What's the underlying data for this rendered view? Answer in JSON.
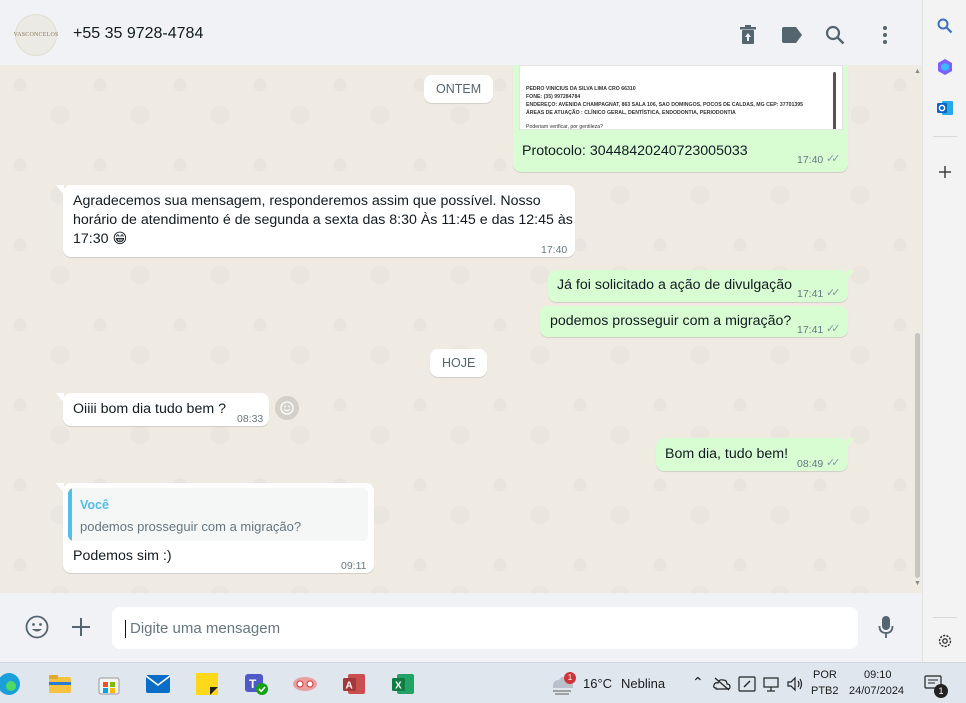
{
  "header": {
    "avatar_text": "VASCONCELOS",
    "contact_name": "+55 35 9728-4784"
  },
  "chat": {
    "date_yesterday": "ONTEM",
    "date_today": "HOJE",
    "doc_lines": [
      "PEDRO VINICIUS DA SILVA LIMA CRO 66310",
      "FONE: (35) 997284784",
      "ENDEREÇO: AVENIDA CHAMPAGNAT, 863 SALA 106, SAO DOMINGOS, POCOS DE CALDAS, MG CEP: 37701395",
      "ÁREAS DE ATUAÇÃO : CLÍNICO GERAL, DENTÍSTICA, ENDODONTIA, PERIODONTIA",
      "Poderiam verificar, por gentileza?"
    ],
    "messages": [
      {
        "text": "Protocolo: 30448420240723005033",
        "time": "17:40"
      },
      {
        "text_lines": [
          "Agradecemos sua mensagem, responderemos assim que possível. Nosso",
          "horário de atendimento é de segunda a sexta das 8:30 Às 11:45 e das 12:45 às",
          "17:30 😁"
        ],
        "time": "17:40"
      },
      {
        "text": "Já foi solicitado a ação de divulgação",
        "time": "17:41"
      },
      {
        "text": "podemos prosseguir com a migração?",
        "time": "17:41"
      },
      {
        "text": "Oiiii bom dia tudo bem ?",
        "time": "08:33"
      },
      {
        "text": "Bom dia, tudo bem!",
        "time": "08:49"
      },
      {
        "reply_author": "Você",
        "reply_text": "podemos prosseguir com a migração?",
        "text": "Podemos sim :)",
        "time": "09:11"
      }
    ]
  },
  "composer": {
    "placeholder": "Digite uma mensagem"
  },
  "taskbar": {
    "weather_temp": "16°C",
    "weather_desc": "Neblina",
    "weather_badge": "1",
    "lang_top": "POR",
    "lang_bottom": "PTB2",
    "clock_time": "09:10",
    "clock_date": "24/07/2024",
    "notif_count": "1"
  },
  "colors": {
    "chat_bg": "#efeae2",
    "outgoing": "#d9fdd3",
    "incoming": "#ffffff",
    "accent": "#53bdeb"
  }
}
